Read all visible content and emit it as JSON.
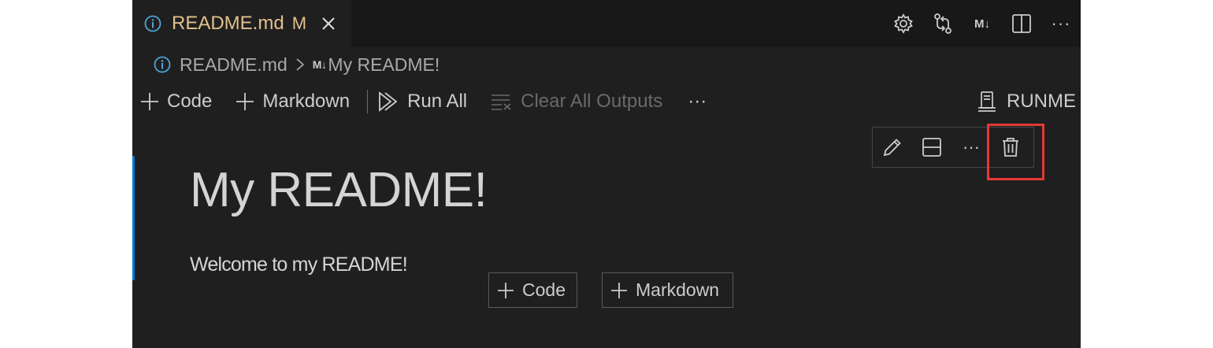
{
  "tab": {
    "name": "README.md",
    "status": "M",
    "icon": "info-icon"
  },
  "title_actions": [
    "gear-icon",
    "git-compare-icon",
    "markdown-preview-icon",
    "split-editor-icon",
    "more-icon"
  ],
  "title_actions_labels": {
    "markdown": "M↓",
    "more": "···"
  },
  "breadcrumb": {
    "file": "README.md",
    "separator": ">",
    "badge": "M↓",
    "section": "My README!"
  },
  "toolbar": {
    "add_code": "Code",
    "add_markdown": "Markdown",
    "run_all": "Run All",
    "clear_outputs": "Clear All Outputs",
    "more": "···",
    "kernel": "RUNME"
  },
  "cell_toolbar": {
    "more": "···"
  },
  "cell": {
    "heading": "My README!",
    "paragraph": "Welcome to my README!"
  },
  "insert": {
    "code": "Code",
    "markdown": "Markdown"
  },
  "colors": {
    "accent": "#0078d4",
    "highlight": "#e53935",
    "modified": "#e2c08d",
    "info": "#4fa3d8"
  }
}
